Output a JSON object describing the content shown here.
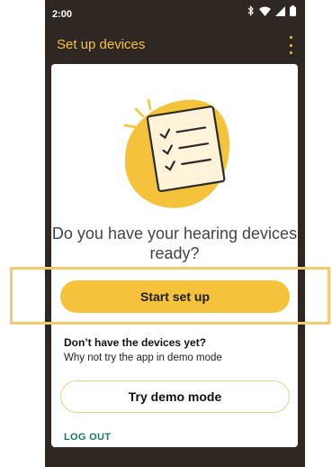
{
  "status_bar": {
    "time": "2:00",
    "icons": [
      "bluetooth-icon",
      "wifi-icon",
      "signal-icon",
      "battery-icon"
    ]
  },
  "app_bar": {
    "title": "Set up devices",
    "menu_icon": "overflow-menu-icon"
  },
  "card": {
    "illustration": "checklist-illustration",
    "question": "Do you have your hearing devices ready?",
    "start_button": "Start set up",
    "no_devices_heading": "Don’t have the devices yet?",
    "no_devices_subtext": "Why not try the app in demo mode",
    "demo_button": "Try demo mode",
    "logout": "LOG OUT"
  },
  "colors": {
    "accent": "#f5c33b",
    "background": "#2e2722",
    "link": "#1c7a5e",
    "highlight": "#f5c96f"
  }
}
